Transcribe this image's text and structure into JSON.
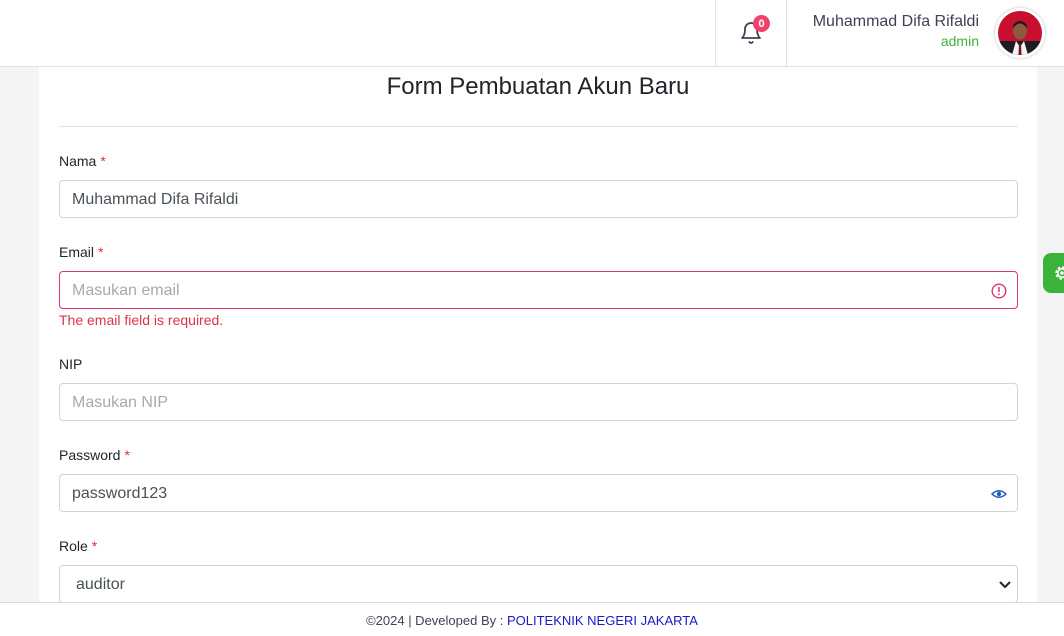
{
  "header": {
    "notification_count": "0",
    "user_name": "Muhammad Difa Rifaldi",
    "user_role": "admin"
  },
  "form": {
    "title": "Form Pembuatan Akun Baru",
    "required_mark": "*",
    "nama": {
      "label": "Nama",
      "value": "Muhammad Difa Rifaldi"
    },
    "email": {
      "label": "Email",
      "placeholder": "Masukan email",
      "error": "The email field is required."
    },
    "nip": {
      "label": "NIP",
      "placeholder": "Masukan NIP"
    },
    "password": {
      "label": "Password",
      "value": "password123"
    },
    "role": {
      "label": "Role",
      "value": "auditor"
    }
  },
  "footer": {
    "text": "©2024 | Developed By : ",
    "link": "POLITEKNIK NEGERI JAKARTA"
  },
  "colors": {
    "accent_green": "#3bb33b",
    "badge_red": "#f1416c",
    "error": "#dc3545",
    "link_blue": "#1b18c6"
  },
  "icons": [
    "bell-icon",
    "user-avatar",
    "error-circle-icon",
    "eye-icon",
    "chevron-down-icon",
    "gear-icon"
  ]
}
